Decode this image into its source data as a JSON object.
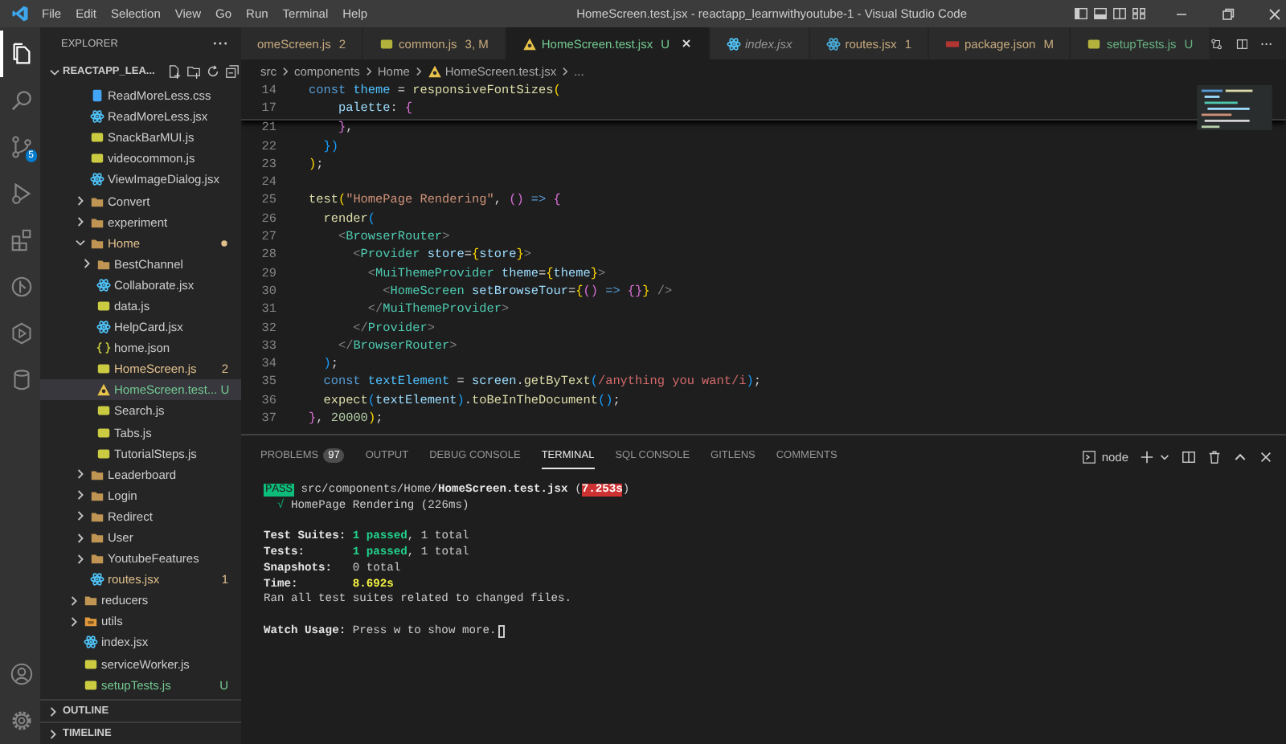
{
  "title_bar": {
    "menu": [
      "File",
      "Edit",
      "Selection",
      "View",
      "Go",
      "Run",
      "Terminal",
      "Help"
    ],
    "title": "HomeScreen.test.jsx - reactapp_learnwithyoutube-1 - Visual Studio Code"
  },
  "activity_bar": {
    "items": [
      {
        "kind": "files",
        "selected": true
      },
      {
        "kind": "search",
        "selected": false
      },
      {
        "kind": "source-control",
        "selected": false,
        "badge": "5"
      },
      {
        "kind": "run",
        "selected": false
      },
      {
        "kind": "extensions",
        "selected": false
      },
      {
        "kind": "gitlens",
        "selected": false
      },
      {
        "kind": "play",
        "selected": false
      },
      {
        "kind": "database",
        "selected": false
      }
    ],
    "bottom": [
      {
        "kind": "account"
      },
      {
        "kind": "settings"
      }
    ]
  },
  "sidebar": {
    "title": "EXPLORER",
    "root": {
      "label": "REACTAPP_LEA...",
      "expanded": true
    },
    "tree": [
      {
        "children": [
          {
            "name": "ReadMoreLess.css",
            "kind": "css",
            "selected": false,
            "modified": false,
            "untracked": false
          },
          {
            "name": "ReadMoreLess.jsx",
            "kind": "react",
            "selected": false,
            "modified": false,
            "untracked": false
          },
          {
            "name": "SnackBarMUI.js",
            "kind": "js",
            "selected": false,
            "modified": false,
            "untracked": false
          },
          {
            "name": "videocommon.js",
            "kind": "js",
            "selected": false,
            "modified": false,
            "untracked": false
          },
          {
            "name": "ViewImageDialog.jsx",
            "kind": "react",
            "selected": false,
            "modified": false,
            "untracked": false
          },
          {
            "name": "Convert",
            "kind": "folder",
            "expanded": false,
            "selected": false,
            "modified": false,
            "untracked": false
          },
          {
            "name": "experiment",
            "kind": "folder",
            "expanded": false,
            "selected": false,
            "modified": false,
            "untracked": false
          },
          {
            "name": "Home",
            "kind": "folder",
            "expanded": true,
            "selected": false,
            "modified": true,
            "untracked": false,
            "decoration": {
              "kind": "dot"
            },
            "children": [
              {
                "name": "BestChannel",
                "kind": "folder",
                "expanded": false,
                "selected": false,
                "modified": false,
                "untracked": false
              },
              {
                "name": "Collaborate.jsx",
                "kind": "react",
                "selected": false,
                "modified": false,
                "untracked": false
              },
              {
                "name": "data.js",
                "kind": "js",
                "selected": false,
                "modified": false,
                "untracked": false
              },
              {
                "name": "HelpCard.jsx",
                "kind": "react",
                "selected": false,
                "modified": false,
                "untracked": false
              },
              {
                "name": "home.json",
                "kind": "json",
                "selected": false,
                "modified": false,
                "untracked": false
              },
              {
                "name": "HomeScreen.js",
                "kind": "js",
                "selected": false,
                "modified": true,
                "untracked": false,
                "decoration": {
                  "kind": "text",
                  "text": "2"
                }
              },
              {
                "name": "HomeScreen.test...",
                "kind": "test",
                "selected": true,
                "modified": false,
                "untracked": true,
                "decoration": {
                  "kind": "text",
                  "text": "U"
                }
              },
              {
                "name": "Search.js",
                "kind": "js",
                "selected": false,
                "modified": false,
                "untracked": false
              },
              {
                "name": "Tabs.js",
                "kind": "js",
                "selected": false,
                "modified": false,
                "untracked": false
              },
              {
                "name": "TutorialSteps.js",
                "kind": "js",
                "selected": false,
                "modified": false,
                "untracked": false
              }
            ]
          },
          {
            "name": "Leaderboard",
            "kind": "folder",
            "expanded": false,
            "selected": false,
            "modified": false,
            "untracked": false
          },
          {
            "name": "Login",
            "kind": "folder",
            "expanded": false,
            "selected": false,
            "modified": false,
            "untracked": false
          },
          {
            "name": "Redirect",
            "kind": "folder",
            "expanded": false,
            "selected": false,
            "modified": false,
            "untracked": false
          },
          {
            "name": "User",
            "kind": "folder",
            "expanded": false,
            "selected": false,
            "modified": false,
            "untracked": false
          },
          {
            "name": "YoutubeFeatures",
            "kind": "folder",
            "expanded": false,
            "selected": false,
            "modified": false,
            "untracked": false
          },
          {
            "name": "routes.jsx",
            "kind": "react",
            "selected": false,
            "modified": true,
            "untracked": false,
            "decoration": {
              "kind": "text",
              "text": "1"
            }
          }
        ]
      },
      {
        "name": "reducers",
        "kind": "folder",
        "expanded": false,
        "selected": false,
        "modified": false,
        "untracked": false
      },
      {
        "name": "utils",
        "kind": "folder-special",
        "expanded": false,
        "selected": false,
        "modified": false,
        "untracked": false
      },
      {
        "name": "index.jsx",
        "kind": "react",
        "selected": false,
        "modified": false,
        "untracked": false
      },
      {
        "name": "serviceWorker.js",
        "kind": "js",
        "selected": false,
        "modified": false,
        "untracked": false
      },
      {
        "name": "setupTests.js",
        "kind": "js",
        "selected": false,
        "modified": false,
        "untracked": true,
        "decoration": {
          "kind": "text",
          "text": "U"
        }
      }
    ],
    "sections": [
      {
        "label": "OUTLINE",
        "expanded": false
      },
      {
        "label": "TIMELINE",
        "expanded": false
      }
    ]
  },
  "editor": {
    "tabs": [
      {
        "label": "omeScreen.js",
        "decoration": "2",
        "modified": true,
        "untracked": false,
        "preview": false,
        "selected": false
      },
      {
        "label": "common.js",
        "kind": "js",
        "decoration": "3, M",
        "modified": true,
        "untracked": false,
        "preview": false,
        "selected": false
      },
      {
        "label": "HomeScreen.test.jsx",
        "kind": "test",
        "decoration": "U",
        "modified": false,
        "untracked": true,
        "preview": false,
        "selected": true
      },
      {
        "label": "index.jsx",
        "kind": "react",
        "modified": false,
        "untracked": false,
        "preview": true,
        "selected": false
      },
      {
        "label": "routes.jsx",
        "kind": "react",
        "decoration": "1",
        "modified": true,
        "untracked": false,
        "preview": false,
        "selected": false
      },
      {
        "label": "package.json",
        "kind": "npm",
        "decoration": "M",
        "modified": true,
        "untracked": false,
        "preview": false,
        "selected": false
      },
      {
        "label": "setupTests.js",
        "kind": "js",
        "decoration": "U",
        "modified": false,
        "untracked": true,
        "preview": false,
        "selected": false
      }
    ],
    "breadcrumbs": [
      {
        "label": "src"
      },
      {
        "label": "components"
      },
      {
        "label": "Home"
      },
      {
        "label": "HomeScreen.test.jsx",
        "kind": "test"
      },
      {
        "label": "..."
      }
    ],
    "sticky_lines": [
      {
        "number": "14",
        "tokens": [
          {
            "kind": "kw",
            "text": "const"
          },
          {
            "kind": "cv",
            "text": " theme"
          },
          {
            "kind": "p",
            "text": " = "
          },
          {
            "kind": "fn",
            "text": "responsiveFontSizes"
          },
          {
            "kind": "b1",
            "text": "("
          }
        ]
      },
      {
        "number": "17",
        "tokens": [
          {
            "kind": "prop",
            "text": "    palette"
          },
          {
            "kind": "p",
            "text": ": "
          },
          {
            "kind": "b2",
            "text": "{"
          }
        ]
      }
    ],
    "lines": [
      {
        "number": "21",
        "tokens": [
          {
            "kind": "b2",
            "text": "    }"
          },
          {
            "kind": "p",
            "text": ","
          }
        ]
      },
      {
        "number": "22",
        "tokens": [
          {
            "kind": "b3",
            "text": "  })"
          }
        ]
      },
      {
        "number": "23",
        "tokens": [
          {
            "kind": "b1",
            "text": ")"
          },
          {
            "kind": "p",
            "text": ";"
          }
        ]
      },
      {
        "number": "24"
      },
      {
        "number": "25",
        "tokens": [
          {
            "kind": "fn",
            "text": "test"
          },
          {
            "kind": "b1",
            "text": "("
          },
          {
            "kind": "str",
            "text": "\"HomePage Rendering\""
          },
          {
            "kind": "p",
            "text": ", "
          },
          {
            "kind": "b2",
            "text": "()"
          },
          {
            "kind": "kw",
            "text": " =>"
          },
          {
            "kind": "b2",
            "text": " {"
          }
        ]
      },
      {
        "number": "26",
        "tokens": [
          {
            "kind": "fn",
            "text": "  render"
          },
          {
            "kind": "b3",
            "text": "("
          }
        ]
      },
      {
        "number": "27",
        "tokens": [
          {
            "kind": "tagp",
            "text": "    <"
          },
          {
            "kind": "tag",
            "text": "BrowserRouter"
          },
          {
            "kind": "tagp",
            "text": ">"
          }
        ]
      },
      {
        "number": "28",
        "tokens": [
          {
            "kind": "tagp",
            "text": "      <"
          },
          {
            "kind": "tag",
            "text": "Provider"
          },
          {
            "kind": "attr",
            "text": " store"
          },
          {
            "kind": "p",
            "text": "="
          },
          {
            "kind": "b1",
            "text": "{"
          },
          {
            "kind": "var",
            "text": "store"
          },
          {
            "kind": "b1",
            "text": "}"
          },
          {
            "kind": "tagp",
            "text": ">"
          }
        ]
      },
      {
        "number": "29",
        "tokens": [
          {
            "kind": "tagp",
            "text": "        <"
          },
          {
            "kind": "tag",
            "text": "MuiThemeProvider"
          },
          {
            "kind": "attr",
            "text": " theme"
          },
          {
            "kind": "p",
            "text": "="
          },
          {
            "kind": "b1",
            "text": "{"
          },
          {
            "kind": "var",
            "text": "theme"
          },
          {
            "kind": "b1",
            "text": "}"
          },
          {
            "kind": "tagp",
            "text": ">"
          }
        ]
      },
      {
        "number": "30",
        "tokens": [
          {
            "kind": "tagp",
            "text": "          <"
          },
          {
            "kind": "tag",
            "text": "HomeScreen"
          },
          {
            "kind": "attr",
            "text": " setBrowseTour"
          },
          {
            "kind": "p",
            "text": "="
          },
          {
            "kind": "b1",
            "text": "{"
          },
          {
            "kind": "b2",
            "text": "()"
          },
          {
            "kind": "kw",
            "text": " =>"
          },
          {
            "kind": "b2",
            "text": " {}"
          },
          {
            "kind": "b1",
            "text": "}"
          },
          {
            "kind": "tagp",
            "text": " />"
          }
        ]
      },
      {
        "number": "31",
        "tokens": [
          {
            "kind": "tagp",
            "text": "        </"
          },
          {
            "kind": "tag",
            "text": "MuiThemeProvider"
          },
          {
            "kind": "tagp",
            "text": ">"
          }
        ]
      },
      {
        "number": "32",
        "tokens": [
          {
            "kind": "tagp",
            "text": "      </"
          },
          {
            "kind": "tag",
            "text": "Provider"
          },
          {
            "kind": "tagp",
            "text": ">"
          }
        ]
      },
      {
        "number": "33",
        "tokens": [
          {
            "kind": "tagp",
            "text": "    </"
          },
          {
            "kind": "tag",
            "text": "BrowserRouter"
          },
          {
            "kind": "tagp",
            "text": ">"
          }
        ]
      },
      {
        "number": "34",
        "tokens": [
          {
            "kind": "b3",
            "text": "  )"
          },
          {
            "kind": "p",
            "text": ";"
          }
        ]
      },
      {
        "number": "35",
        "tokens": [
          {
            "kind": "kw",
            "text": "  const"
          },
          {
            "kind": "cv",
            "text": " textElement"
          },
          {
            "kind": "p",
            "text": " = "
          },
          {
            "kind": "var",
            "text": "screen"
          },
          {
            "kind": "p",
            "text": "."
          },
          {
            "kind": "fn",
            "text": "getByText"
          },
          {
            "kind": "b3",
            "text": "("
          },
          {
            "kind": "re",
            "text": "/anything you want/i"
          },
          {
            "kind": "b3",
            "text": ")"
          },
          {
            "kind": "p",
            "text": ";"
          }
        ]
      },
      {
        "number": "36",
        "tokens": [
          {
            "kind": "fn",
            "text": "  expect"
          },
          {
            "kind": "b3",
            "text": "("
          },
          {
            "kind": "var",
            "text": "textElement"
          },
          {
            "kind": "b3",
            "text": ")"
          },
          {
            "kind": "p",
            "text": "."
          },
          {
            "kind": "fn",
            "text": "toBeInTheDocument"
          },
          {
            "kind": "b3",
            "text": "()"
          },
          {
            "kind": "p",
            "text": ";"
          }
        ]
      },
      {
        "number": "37",
        "tokens": [
          {
            "kind": "b2",
            "text": "}"
          },
          {
            "kind": "p",
            "text": ", "
          },
          {
            "kind": "num",
            "text": "20000"
          },
          {
            "kind": "b1",
            "text": ")"
          },
          {
            "kind": "p",
            "text": ";"
          }
        ]
      }
    ]
  },
  "panel": {
    "tabs": [
      {
        "label": "PROBLEMS",
        "badge": "97",
        "selected": false
      },
      {
        "label": "OUTPUT",
        "selected": false
      },
      {
        "label": "DEBUG CONSOLE",
        "selected": false
      },
      {
        "label": "TERMINAL",
        "selected": true
      },
      {
        "label": "SQL CONSOLE",
        "selected": false
      },
      {
        "label": "GITLENS",
        "selected": false
      },
      {
        "label": "COMMENTS",
        "selected": false
      }
    ],
    "terminal_name": "node",
    "terminal": {
      "cursor": true,
      "lines": [
        {
          "kind": "text",
          "tokens": [
            {
              "kind": "pass",
              "text": "PASS"
            },
            {
              "kind": "p",
              "text": " src/components/Home/"
            },
            {
              "kind": "bold",
              "text": "HomeScreen.test.jsx"
            },
            {
              "kind": "p",
              "text": " ("
            },
            {
              "kind": "slow",
              "text": "7.253s"
            },
            {
              "kind": "p",
              "text": ")"
            }
          ]
        },
        {
          "kind": "text",
          "tokens": [
            {
              "kind": "check",
              "text": "  √"
            },
            {
              "kind": "p",
              "text": " HomePage Rendering (226ms)"
            }
          ]
        },
        {
          "kind": "blank"
        },
        {
          "kind": "text",
          "tokens": [
            {
              "kind": "bold",
              "text": "Test Suites: "
            },
            {
              "kind": "ok",
              "text": "1 passed"
            },
            {
              "kind": "p",
              "text": ", 1 total"
            }
          ]
        },
        {
          "kind": "text",
          "tokens": [
            {
              "kind": "bold",
              "text": "Tests:       "
            },
            {
              "kind": "ok",
              "text": "1 passed"
            },
            {
              "kind": "p",
              "text": ", 1 total"
            }
          ]
        },
        {
          "kind": "text",
          "tokens": [
            {
              "kind": "bold",
              "text": "Snapshots:   "
            },
            {
              "kind": "p",
              "text": "0 total"
            }
          ]
        },
        {
          "kind": "text",
          "tokens": [
            {
              "kind": "bold",
              "text": "Time:        "
            },
            {
              "kind": "warn",
              "text": "8.692s"
            }
          ]
        },
        {
          "kind": "text",
          "tokens": [
            {
              "kind": "p",
              "text": "Ran all test suites related to changed files."
            }
          ]
        },
        {
          "kind": "blank"
        },
        {
          "kind": "text",
          "tokens": [
            {
              "kind": "bold",
              "text": "Watch Usage: "
            },
            {
              "kind": "p",
              "text": "Press w to show more."
            }
          ]
        }
      ]
    }
  }
}
